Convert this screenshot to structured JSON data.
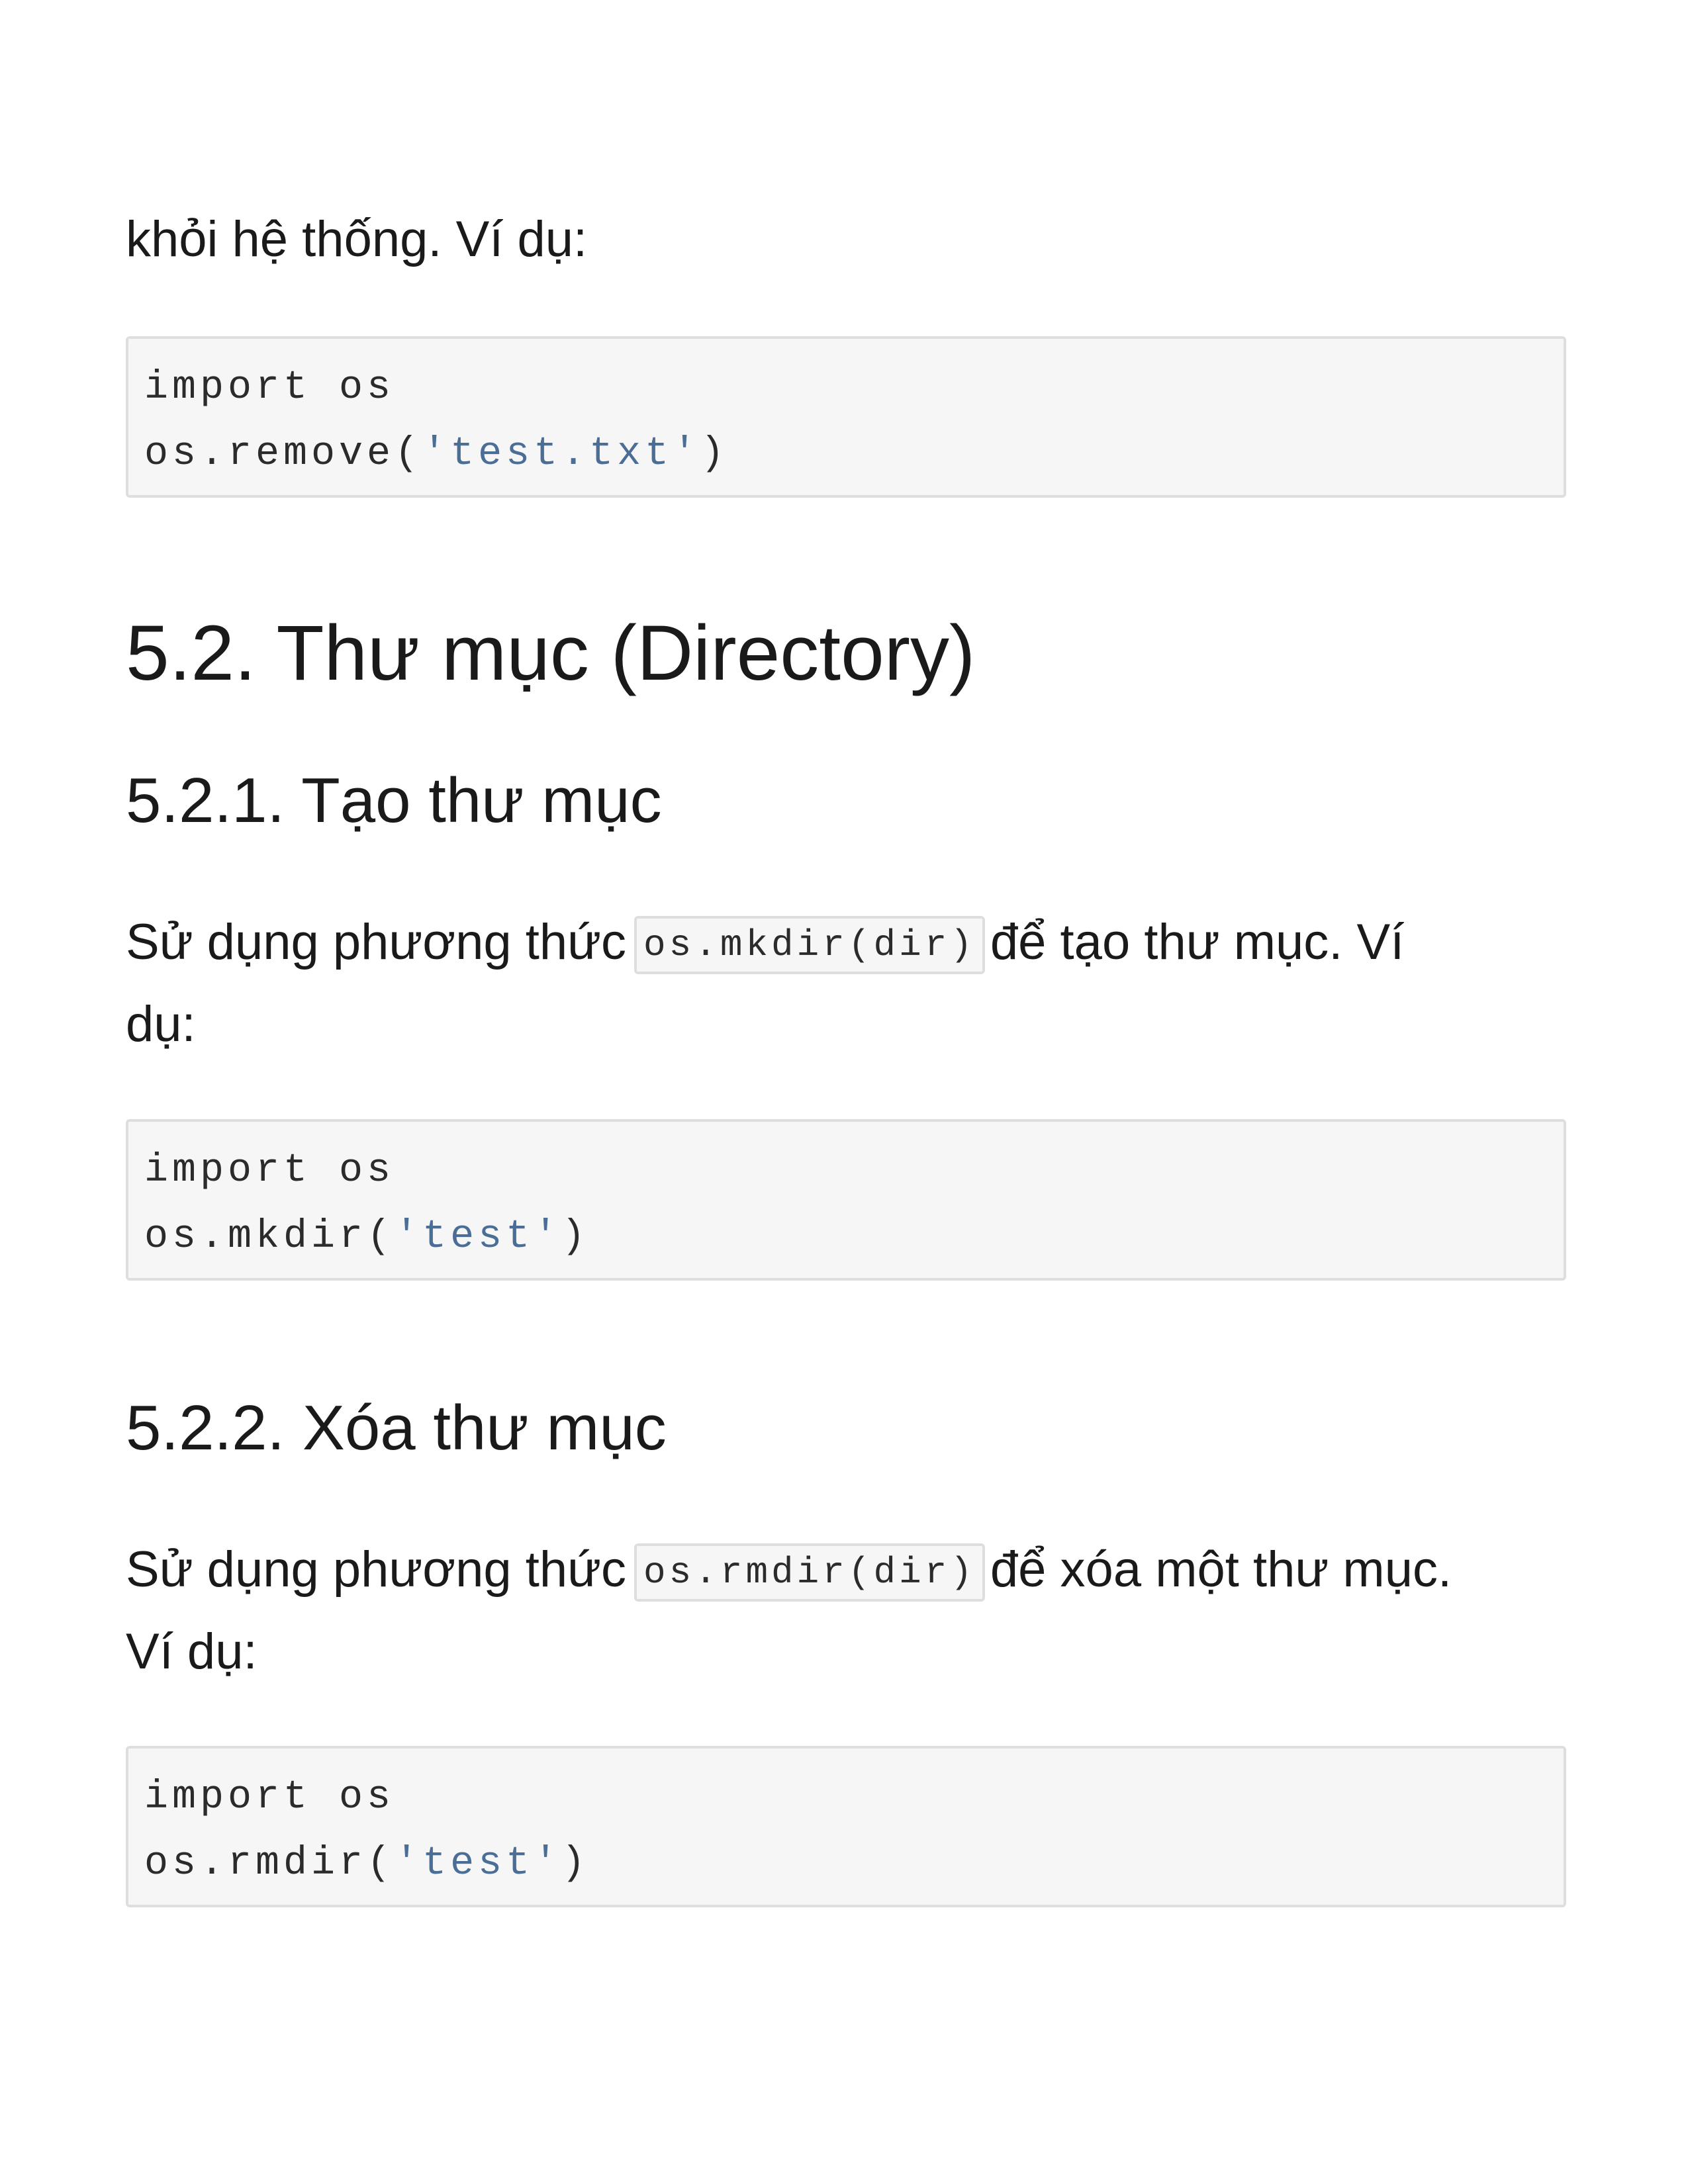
{
  "intro": {
    "text": "khỏi hệ thống. Ví dụ:"
  },
  "code1": {
    "line1": "import os",
    "line2_pre": "os.remove(",
    "line2_str": "'test.txt'",
    "line2_post": ")"
  },
  "section": {
    "title": "5.2. Thư mục (Directory)"
  },
  "sub1": {
    "title": "5.2.1. Tạo thư mục",
    "text_before": "Sử dụng phương thức",
    "code": "os.mkdir(dir)",
    "text_after": "để tạo thư mục. Ví",
    "text_line2": "dụ:"
  },
  "code2": {
    "line1": "import os",
    "line2_pre": "os.mkdir(",
    "line2_str": "'test'",
    "line2_post": ")"
  },
  "sub2": {
    "title": "5.2.2. Xóa thư mục",
    "text_before": "Sử dụng phương thức",
    "code": "os.rmdir(dir)",
    "text_after": "để xóa một thư mục.",
    "text_line2": "Ví dụ:"
  },
  "code3": {
    "line1": "import os",
    "line2_pre": "os.rmdir(",
    "line2_str": "'test'",
    "line2_post": ")"
  }
}
